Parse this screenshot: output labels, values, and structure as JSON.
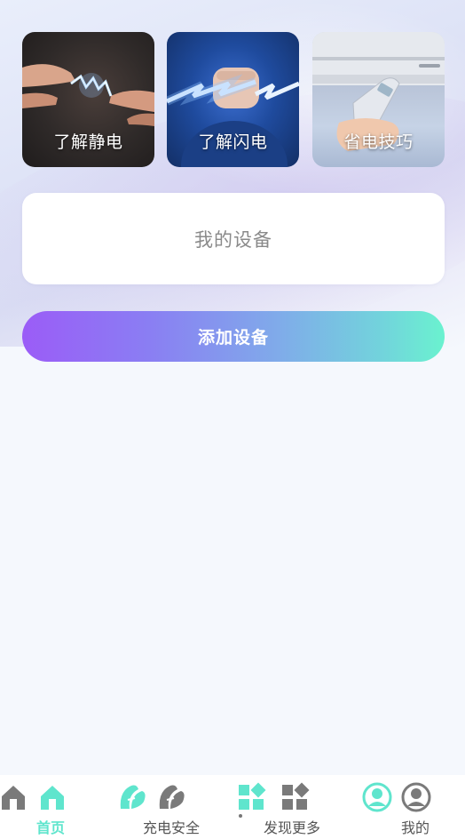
{
  "topics": [
    {
      "label": "了解静电",
      "icon": "static-electricity-image"
    },
    {
      "label": "了解闪电",
      "icon": "lightning-fist-image"
    },
    {
      "label": "省电技巧",
      "icon": "air-conditioner-remote-image"
    }
  ],
  "devices": {
    "title": "我的设备"
  },
  "actions": {
    "add_device": "添加设备"
  },
  "tabbar": {
    "items": [
      {
        "label": "首页",
        "icon": "home-icon",
        "active": true
      },
      {
        "label": "充电安全",
        "icon": "leaf-icon",
        "active": false
      },
      {
        "label": "发现更多",
        "icon": "apps-grid-icon",
        "active": false
      },
      {
        "label": "我的",
        "icon": "user-icon",
        "active": false
      }
    ]
  },
  "colors": {
    "accent": "#5fe5cd",
    "button_gradient_start": "#9b5cf7",
    "button_gradient_end": "#6af2cf",
    "inactive_icon": "#7a7a7a"
  }
}
